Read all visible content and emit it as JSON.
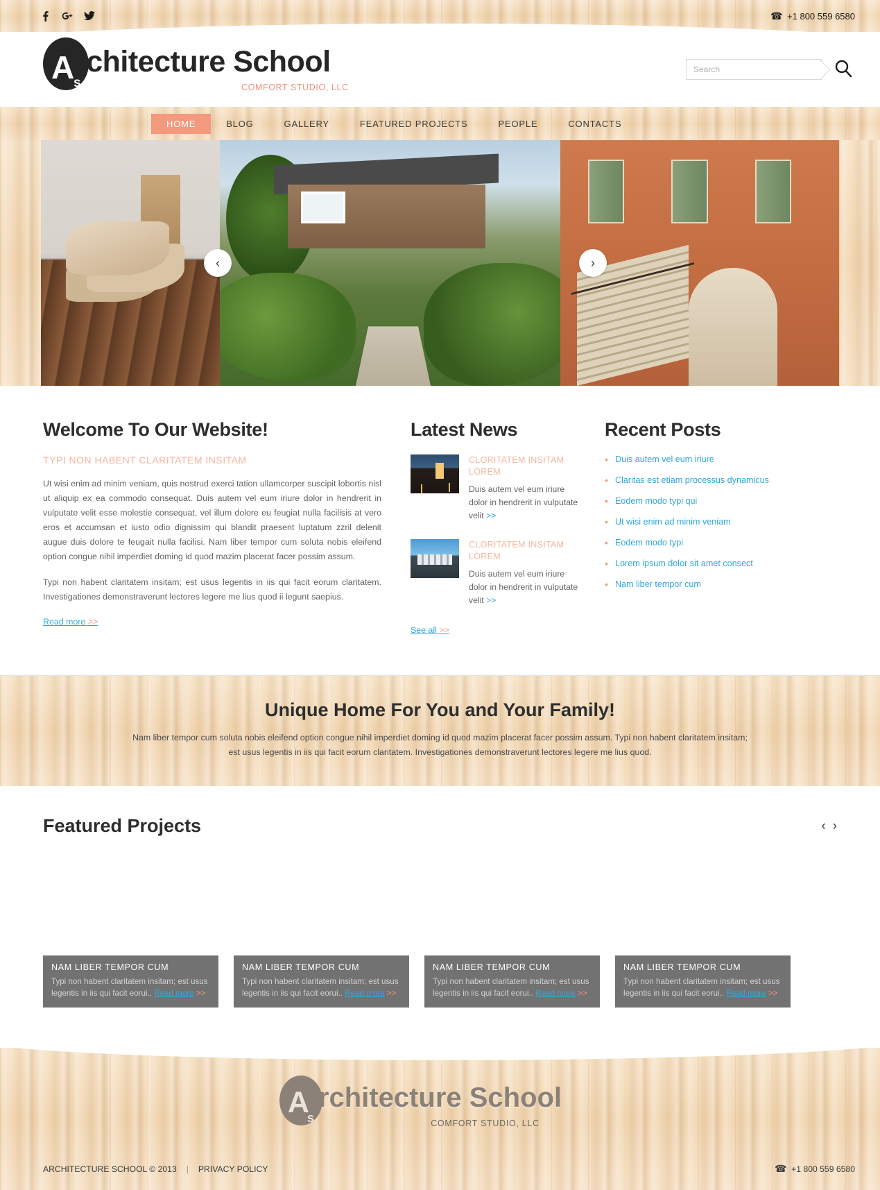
{
  "topbar": {
    "social": [
      {
        "name": "facebook-icon",
        "glyph": "f"
      },
      {
        "name": "google-plus-icon",
        "glyph": "g+"
      },
      {
        "name": "twitter-icon",
        "glyph": "t"
      }
    ],
    "phone": "+1 800 559 6580"
  },
  "header": {
    "logo_letter": "A",
    "logo_sub_letter": "s",
    "title": "rchitecture School",
    "tagline": "COMFORT STUDIO, LLC",
    "search_placeholder": "Search",
    "search_value": ""
  },
  "nav": {
    "items": [
      {
        "label": "HOME",
        "active": true
      },
      {
        "label": "BLOG",
        "active": false
      },
      {
        "label": "GALLERY",
        "active": false
      },
      {
        "label": "FEATURED PROJECTS",
        "active": false
      },
      {
        "label": "PEOPLE",
        "active": false
      },
      {
        "label": "CONTACTS",
        "active": false
      }
    ]
  },
  "slider": {
    "prev_label": "‹",
    "next_label": "›",
    "slides": [
      {
        "name": "slide-interior-deck"
      },
      {
        "name": "slide-wooden-house-garden"
      },
      {
        "name": "slide-terracotta-building"
      }
    ]
  },
  "welcome": {
    "title": "Welcome To Our Website!",
    "subtitle": "TYPI NON HABENT CLARITATEM INSITAM",
    "paragraph1": "Ut wisi enim ad minim veniam, quis nostrud exerci tation ullamcorper suscipit lobortis nisl ut aliquip ex ea commodo consequat. Duis autem vel eum iriure dolor in hendrerit in vulputate velit esse molestie consequat, vel illum dolore eu feugiat nulla facilisis at vero eros et accumsan et iusto odio dignissim qui blandit praesent luptatum zzril delenit augue duis dolore te feugait nulla facilisi. Nam liber tempor cum soluta nobis eleifend option congue nihil imperdiet doming id quod mazim placerat facer possim assum.",
    "paragraph2": "Typi non habent claritatem insitam; est usus legentis in iis qui facit eorum claritatem. Investigationes demonstraverunt lectores legere me lius quod ii legunt saepius.",
    "read_more": "Read more",
    "chevrons": ">>"
  },
  "news": {
    "title": "Latest News",
    "items": [
      {
        "title": "CLORITATEM INSITAM LOREM",
        "text": "Duis autem vel eum iriure dolor in hendrerit in vulputate velit",
        "chevrons": ">>",
        "thumb": "news-thumb-night-house"
      },
      {
        "title": "CLORITATEM INSITAM LOREM",
        "text": "Duis autem vel eum iriure dolor in hendrerit in vulputate velit",
        "chevrons": ">>",
        "thumb": "news-thumb-modern-house"
      }
    ],
    "see_all": "See all",
    "see_all_chevrons": ">>"
  },
  "posts": {
    "title": "Recent Posts",
    "items": [
      "Duis autem vel eum iriure",
      "Claritas est etiam processus dynamicus",
      "Eodem modo typi qui",
      "Ut wisi enim ad minim veniam",
      "Eodem modo typi",
      "Lorem ipsum dolor sit amet consect",
      "Nam liber tempor cum"
    ]
  },
  "promo": {
    "title": "Unique Home For You and Your Family!",
    "text": "Nam liber tempor cum soluta nobis eleifend option congue nihil imperdiet doming id quod mazim placerat facer possim assum. Typi non habent claritatem insitam; est usus legentis in iis qui facit eorum claritatem. Investigationes demonstraverunt lectores legere me lius quod."
  },
  "featured": {
    "title": "Featured Projects",
    "prev_label": "‹",
    "next_label": "›",
    "cards": [
      {
        "title": "NAM LIBER TEMPOR CUM",
        "text": "Typi non habent claritatem insitam; est usus legentis in iis qui facit eorui..",
        "link": "Read more",
        "chevrons": ">>",
        "image": "project-white-house-vines"
      },
      {
        "title": "NAM LIBER TEMPOR CUM",
        "text": "Typi non habent claritatem insitam; est usus legentis in iis qui facit eorui..",
        "link": "Read more",
        "chevrons": ">>",
        "image": "project-modern-villa"
      },
      {
        "title": "NAM LIBER TEMPOR CUM",
        "text": "Typi non habent claritatem insitam; est usus legentis in iis qui facit eorui..",
        "link": "Read more",
        "chevrons": ">>",
        "image": "project-brick-house"
      },
      {
        "title": "NAM LIBER TEMPOR CUM",
        "text": "Typi non habent claritatem insitam; est usus legentis in iis qui facit eorui..",
        "link": "Read more",
        "chevrons": ">>",
        "image": "project-white-modern-home"
      }
    ]
  },
  "footer": {
    "logo_letter": "A",
    "logo_sub_letter": "s",
    "title": "rchitecture School",
    "tagline": "COMFORT STUDIO, LLC",
    "copyright": "ARCHITECTURE SCHOOL © 2013",
    "separator": "|",
    "privacy": "PRIVACY POLICY",
    "phone": "+1 800 559 6580"
  },
  "colors": {
    "accent": "#f2997e",
    "link": "#2fa8dd",
    "wood": "#f2d9b8",
    "dark": "#262626"
  }
}
